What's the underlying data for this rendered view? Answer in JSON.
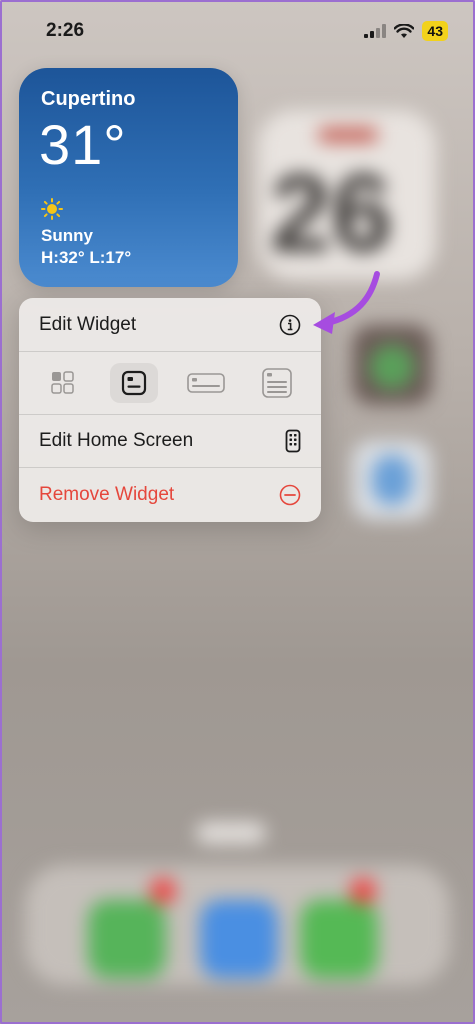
{
  "status_bar": {
    "time": "2:26",
    "battery": "43"
  },
  "weather_widget": {
    "city": "Cupertino",
    "temperature": "31°",
    "icon": "sun-icon",
    "condition": "Sunny",
    "high_low": "H:32° L:17°"
  },
  "home_background": {
    "calendar_day": "26"
  },
  "context_menu": {
    "edit_widget": {
      "label": "Edit Widget",
      "icon": "info-circle-icon"
    },
    "sizes": [
      {
        "name": "grid-size-icon",
        "selected": false
      },
      {
        "name": "small-size-icon",
        "selected": true
      },
      {
        "name": "medium-size-icon",
        "selected": false
      },
      {
        "name": "large-size-icon",
        "selected": false
      }
    ],
    "edit_home_screen": {
      "label": "Edit Home Screen",
      "icon": "phone-screen-icon"
    },
    "remove_widget": {
      "label": "Remove Widget",
      "icon": "minus-circle-icon"
    }
  },
  "colors": {
    "destructive": "#e5473c",
    "annotation_arrow": "#a64ce0",
    "battery": "#f2d21b"
  }
}
